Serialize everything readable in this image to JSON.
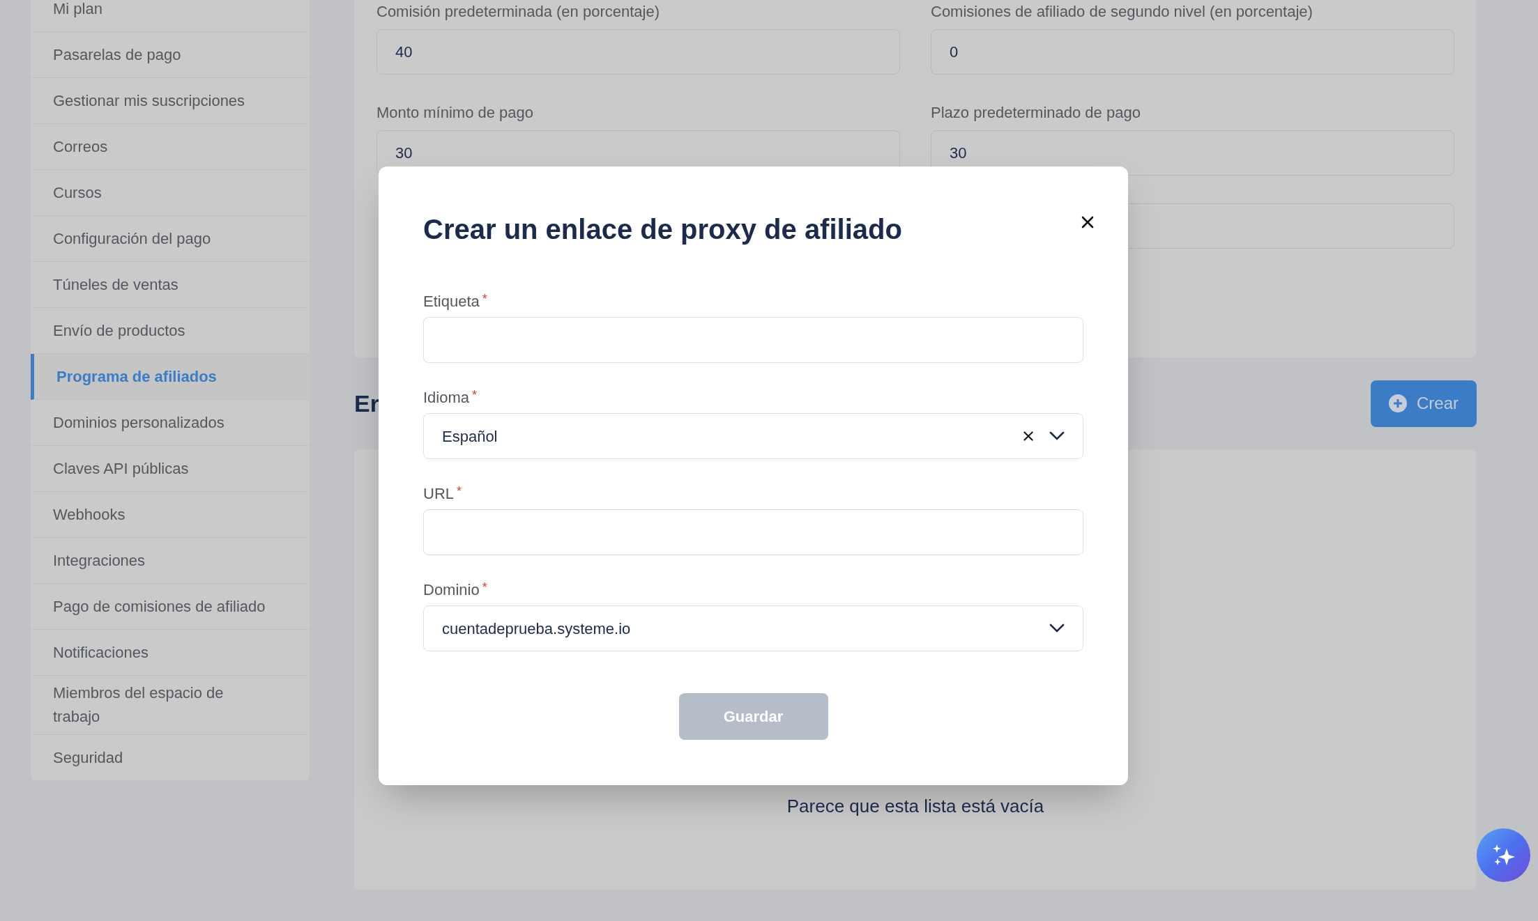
{
  "sidebar": {
    "items": [
      {
        "label": "Mi plan",
        "selected": false
      },
      {
        "label": "Pasarelas de pago",
        "selected": false
      },
      {
        "label": "Gestionar mis suscripciones",
        "selected": false
      },
      {
        "label": "Correos",
        "selected": false
      },
      {
        "label": "Cursos",
        "selected": false
      },
      {
        "label": "Configuración del pago",
        "selected": false
      },
      {
        "label": "Túneles de ventas",
        "selected": false
      },
      {
        "label": "Envío de productos",
        "selected": false
      },
      {
        "label": "Programa de afiliados",
        "selected": true
      },
      {
        "label": "Dominios personalizados",
        "selected": false
      },
      {
        "label": "Claves API públicas",
        "selected": false
      },
      {
        "label": "Webhooks",
        "selected": false
      },
      {
        "label": "Integraciones",
        "selected": false
      },
      {
        "label": "Pago de comisiones de afiliado",
        "selected": false
      },
      {
        "label": "Notificaciones",
        "selected": false
      },
      {
        "label": "Miembros del espacio de trabajo",
        "selected": false
      },
      {
        "label": "Seguridad",
        "selected": false
      }
    ]
  },
  "settings": {
    "fields": [
      {
        "label": "Comisión predeterminada (en porcentaje)",
        "value": "40"
      },
      {
        "label": "Comisiones de afiliado de segundo nivel (en porcentaje)",
        "value": "0"
      },
      {
        "label": "Monto mínimo de pago",
        "value": "30"
      },
      {
        "label": "Plazo predeterminado de pago",
        "value": "30"
      }
    ]
  },
  "links_section": {
    "heading": "Er",
    "create_button": "Crear",
    "empty_message": "Parece que esta lista está vacía"
  },
  "modal": {
    "title": "Crear un enlace de proxy de afiliado",
    "required_mark": "*",
    "fields": [
      {
        "kind": "text",
        "label": "Etiqueta"
      },
      {
        "kind": "select",
        "label": "Idioma",
        "value": "Español",
        "clearable": true
      },
      {
        "kind": "text",
        "label": "URL"
      },
      {
        "kind": "select",
        "label": "Dominio",
        "value": "cuentadeprueba.systeme.io",
        "clearable": false
      }
    ],
    "save_button": {
      "label": "Guardar",
      "disabled": true
    }
  }
}
